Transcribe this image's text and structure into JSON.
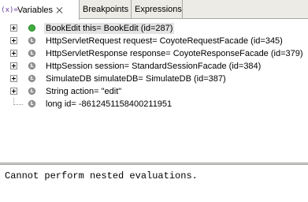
{
  "tabs": [
    {
      "label": "Variables",
      "icon": "variables-icon",
      "active": true,
      "closable": true
    },
    {
      "label": "Breakpoints",
      "active": false
    },
    {
      "label": "Expressions",
      "active": false
    }
  ],
  "variables_icon_text": "(x)=",
  "variables": [
    {
      "label": "BookEdit this= BookEdit  (id=287)",
      "status": "green",
      "expandable": true,
      "selected": true
    },
    {
      "label": "HttpServletRequest request= CoyoteRequestFacade  (id=345)",
      "status": "grey",
      "expandable": true,
      "selected": false
    },
    {
      "label": "HttpServletResponse response= CoyoteResponseFacade  (id=379)",
      "status": "grey",
      "expandable": true,
      "selected": false
    },
    {
      "label": "HttpSession session= StandardSessionFacade  (id=384)",
      "status": "grey",
      "expandable": true,
      "selected": false
    },
    {
      "label": "SimulateDB simulateDB= SimulateDB  (id=387)",
      "status": "grey",
      "expandable": true,
      "selected": false
    },
    {
      "label": "String action= \"edit\"",
      "status": "grey",
      "expandable": true,
      "selected": false
    },
    {
      "label": "long id= -8612451158400211951",
      "status": "grey",
      "expandable": false,
      "selected": false
    }
  ],
  "status_dot_letter": "L",
  "details": {
    "text": "Cannot perform nested evaluations."
  }
}
